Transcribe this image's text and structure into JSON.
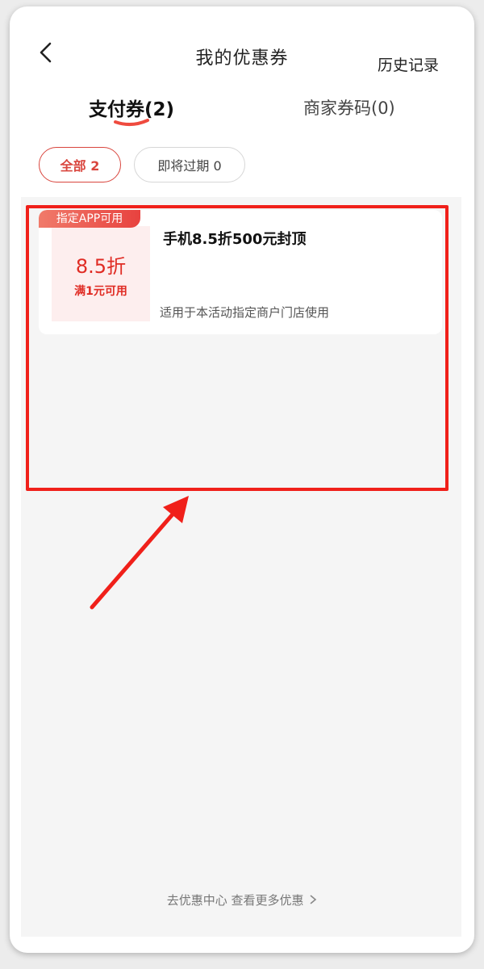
{
  "header": {
    "title": "我的优惠券",
    "history_label": "历史记录"
  },
  "tabs": [
    {
      "label": "支付券(2)",
      "active": true
    },
    {
      "label": "商家券码(0)",
      "active": false
    }
  ],
  "filters": [
    {
      "label": "全部 2",
      "active": true
    },
    {
      "label": "即将过期 0",
      "active": false
    }
  ],
  "coupons": [
    {
      "badge": "指定APP可用",
      "value": "8.5折",
      "condition": "满1元可用",
      "title": "手机8.5折500元封顶",
      "description": "适用于本活动指定商户门店使用"
    }
  ],
  "footer": {
    "more_text": "去优惠中心 查看更多优惠"
  },
  "colors": {
    "accent": "#e02c24",
    "highlight": "#f0201a"
  }
}
